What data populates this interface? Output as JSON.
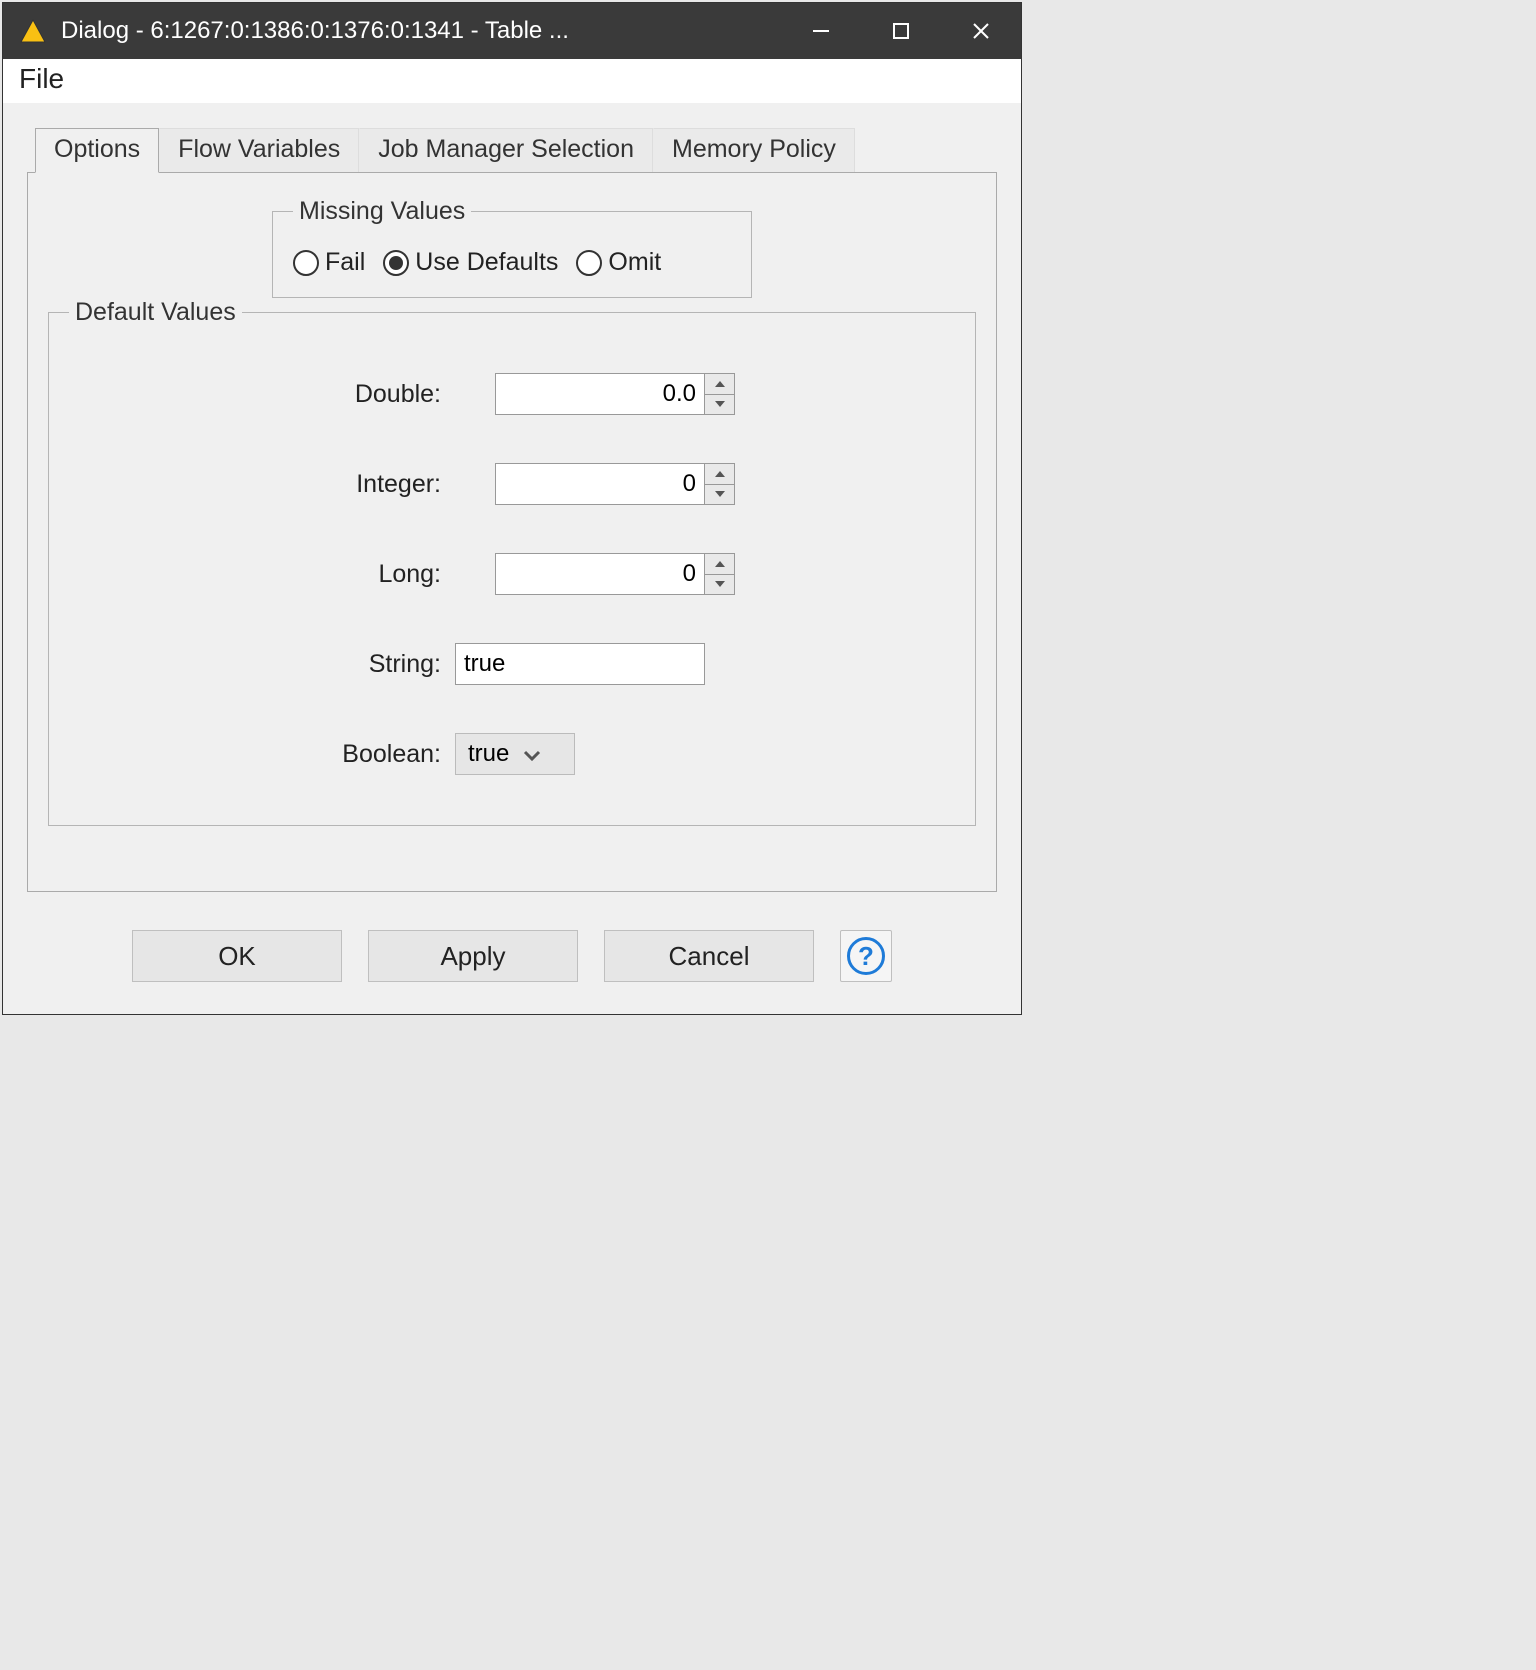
{
  "window": {
    "title": "Dialog - 6:1267:0:1386:0:1376:0:1341 - Table ..."
  },
  "menubar": {
    "file": "File"
  },
  "tabs": {
    "options": "Options",
    "flow_variables": "Flow Variables",
    "job_manager": "Job Manager Selection",
    "memory_policy": "Memory Policy"
  },
  "missing_values": {
    "legend": "Missing Values",
    "fail": "Fail",
    "use_defaults": "Use Defaults",
    "omit": "Omit",
    "selected": "use_defaults"
  },
  "default_values": {
    "legend": "Default Values",
    "double_label": "Double:",
    "double_value": "0.0",
    "integer_label": "Integer:",
    "integer_value": "0",
    "long_label": "Long:",
    "long_value": "0",
    "string_label": "String:",
    "string_value": "true",
    "boolean_label": "Boolean:",
    "boolean_value": "true"
  },
  "buttons": {
    "ok": "OK",
    "apply": "Apply",
    "cancel": "Cancel",
    "help": "?"
  }
}
